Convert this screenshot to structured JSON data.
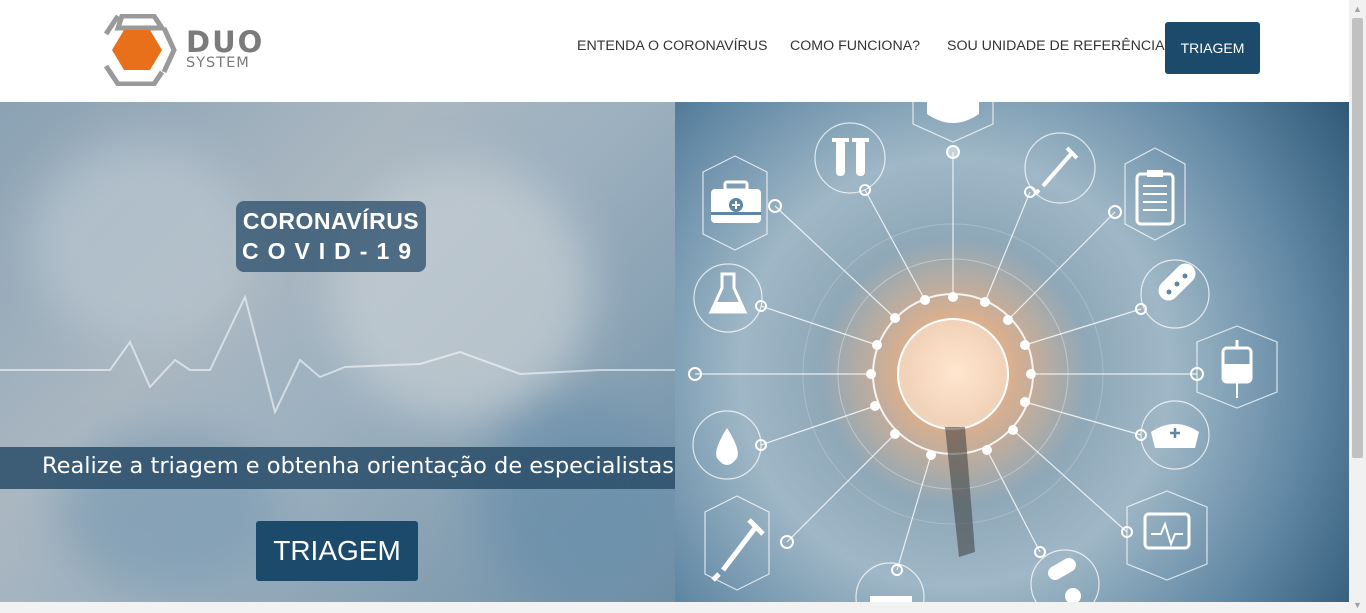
{
  "brand": {
    "name": "DUO",
    "sub": "SYSTEM",
    "accent": "#e8701a",
    "gray": "#7b7b7b"
  },
  "nav": {
    "items": [
      {
        "label": "ENTENDA O CORONAVÍRUS"
      },
      {
        "label": "COMO FUNCIONA?"
      },
      {
        "label": "SOU UNIDADE DE REFERÊNCIA"
      }
    ],
    "cta": "TRIAGEM"
  },
  "hero": {
    "badge_title": "CORONAVÍRUS",
    "badge_sub": "COVID-19",
    "tagline": "Realize a triagem e obtenha orientação de especialistas",
    "cta": "TRIAGEM"
  },
  "icons": [
    "medical-kit-icon",
    "test-tubes-icon",
    "shield-heart-icon",
    "syringe-dropper-icon",
    "clipboard-icon",
    "flask-icon",
    "pills-icon",
    "doctor-icon",
    "iv-bag-icon",
    "drop-icon",
    "nurse-cap-icon",
    "syringe-icon",
    "monitor-icon",
    "capsules-icon",
    "ambulance-icon"
  ],
  "colors": {
    "primary": "#1c4a6b",
    "tagline_bg": "#2a4e6a",
    "badge_bg": "#30526e"
  }
}
